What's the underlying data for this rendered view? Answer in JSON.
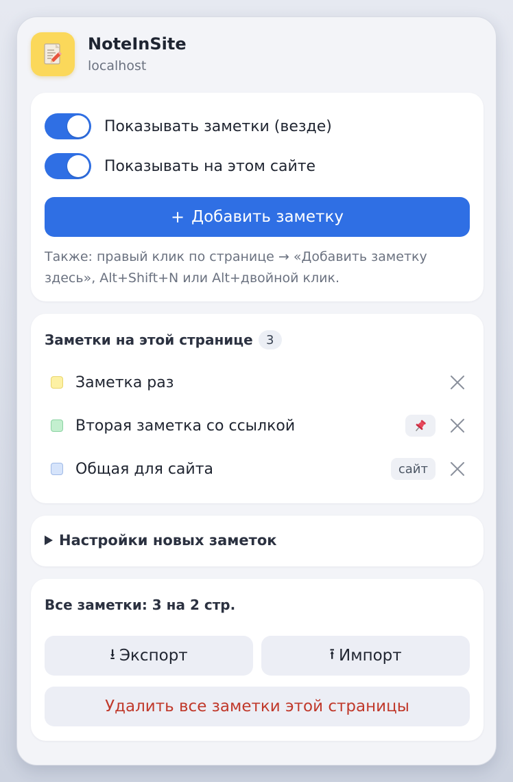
{
  "app": {
    "title": "NoteInSite",
    "host": "localhost"
  },
  "toggles": [
    {
      "label": "Показывать заметки (везде)",
      "on": true
    },
    {
      "label": "Показывать на этом сайте",
      "on": true
    }
  ],
  "add_button": {
    "icon": "+",
    "label": "Добавить заметку"
  },
  "hint": "Также: правый клик по странице → «Добавить заметку здесь», Alt+Shift+N или Alt+двойной клик.",
  "notes_section": {
    "title": "Заметки на этой странице",
    "count": "3",
    "items": [
      {
        "text": "Заметка раз",
        "color": "#fdf1a4",
        "border": "#e9d56a",
        "tag": null
      },
      {
        "text": "Вторая заметка со ссылкой",
        "color": "#c3efcf",
        "border": "#8bd3a2",
        "tag": "pin-icon"
      },
      {
        "text": "Общая для сайта",
        "color": "#d6e4fb",
        "border": "#9fb9e6",
        "tag": "сайт"
      }
    ]
  },
  "settings": {
    "label": "Настройки новых заметок"
  },
  "footer": {
    "total": "Все заметки: 3 на 2 стр.",
    "export_icon": "⭳",
    "export_label": "Экспорт",
    "import_icon": "⭱",
    "import_label": "Импорт",
    "delete_label": "Удалить все заметки этой страницы"
  },
  "colors": {
    "accent": "#2f6fe4",
    "danger": "#c0392b",
    "logo_bg": "#fbd85a"
  }
}
